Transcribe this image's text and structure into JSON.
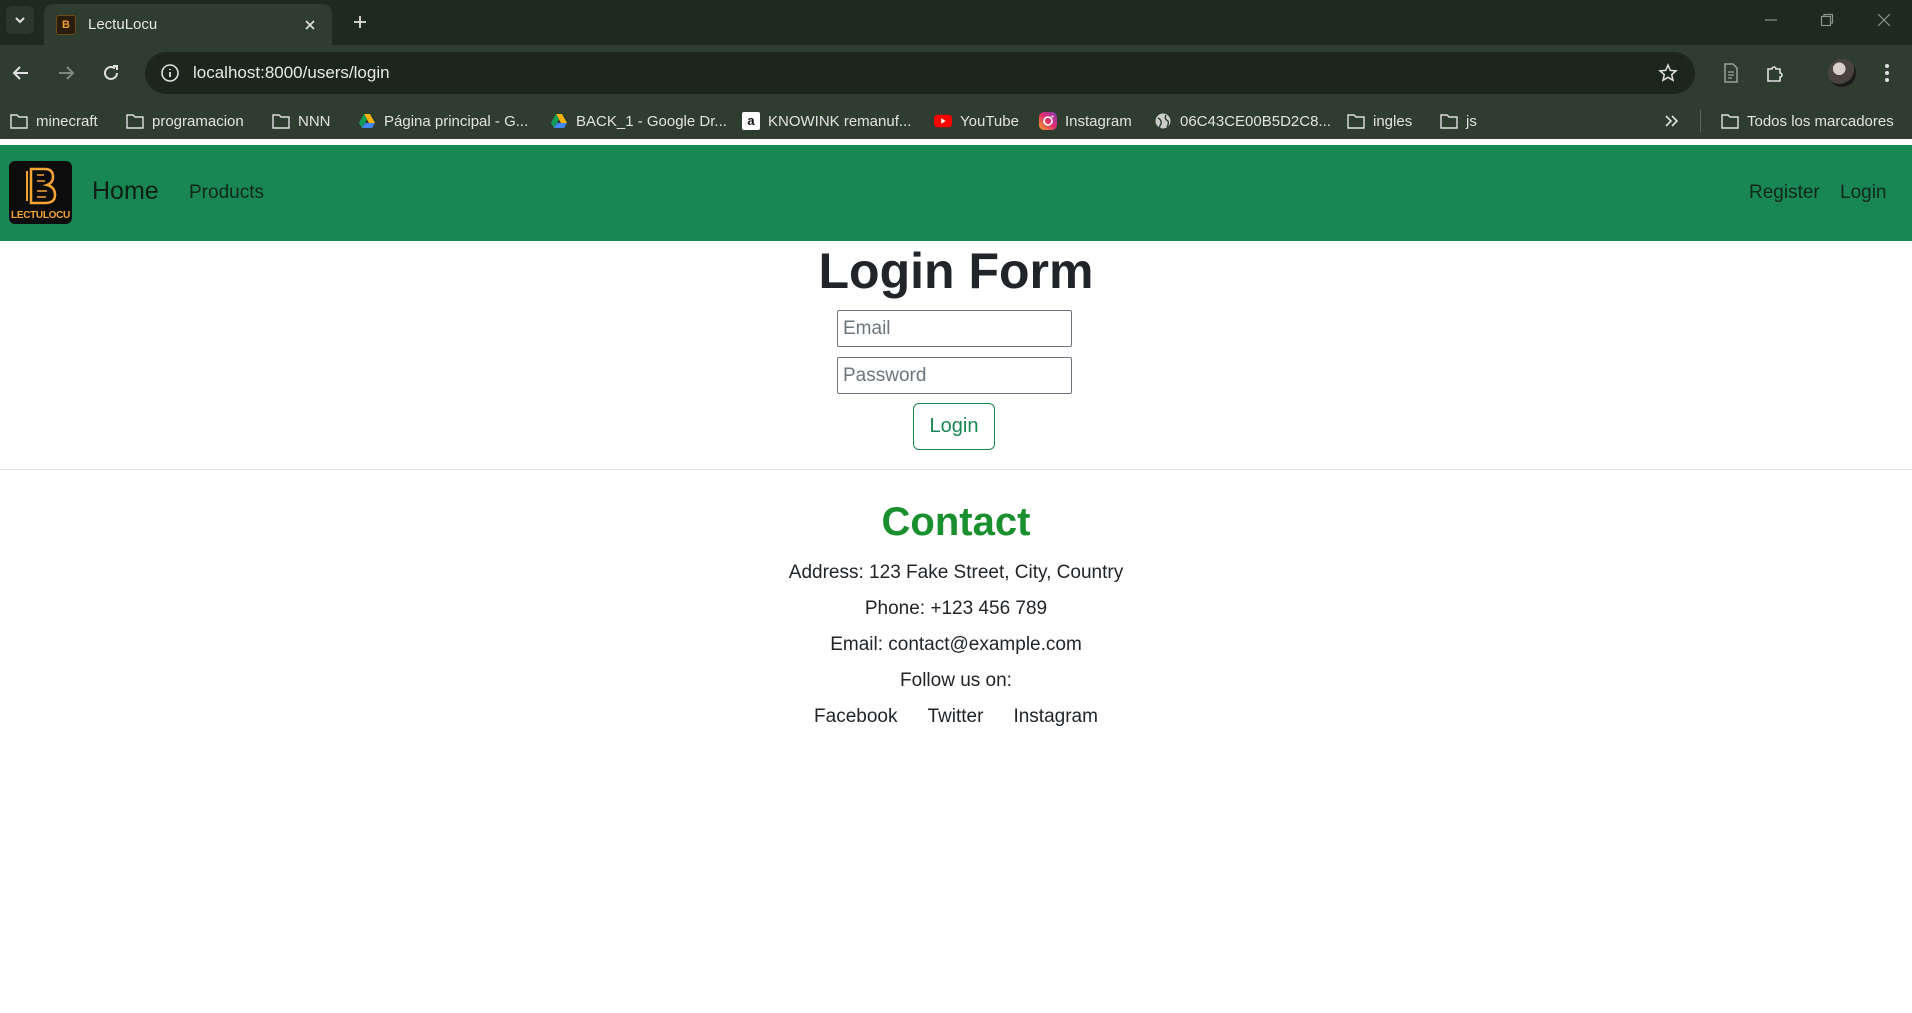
{
  "browser": {
    "tab_title": "LectuLocu",
    "url": "localhost:8000/users/login",
    "bookmarks": [
      {
        "label": "minecraft",
        "icon": "folder-icon"
      },
      {
        "label": "programacion",
        "icon": "folder-icon"
      },
      {
        "label": "NNN",
        "icon": "folder-icon"
      },
      {
        "label": "Página principal - G...",
        "icon": "google-drive-icon"
      },
      {
        "label": "BACK_1 - Google Dr...",
        "icon": "google-drive-icon"
      },
      {
        "label": "KNOWINK remanuf...",
        "icon": "amazon-icon"
      },
      {
        "label": "YouTube",
        "icon": "youtube-icon"
      },
      {
        "label": "Instagram",
        "icon": "instagram-icon"
      },
      {
        "label": "06C43CE00B5D2C8...",
        "icon": "globe-icon"
      },
      {
        "label": "ingles",
        "icon": "folder-icon"
      },
      {
        "label": "js",
        "icon": "folder-icon"
      }
    ],
    "all_bookmarks_label": "Todos los marcadores"
  },
  "navbar": {
    "logo_text": "LECTULOCU",
    "brand": "Home",
    "links": {
      "products": "Products",
      "register": "Register",
      "login": "Login"
    }
  },
  "login_form": {
    "title": "Login Form",
    "email_placeholder": "Email",
    "password_placeholder": "Password",
    "submit_label": "Login"
  },
  "contact": {
    "title": "Contact",
    "address": "Address: 123 Fake Street, City, Country",
    "phone": "Phone: +123 456 789",
    "email": "Email: contact@example.com",
    "follow": "Follow us on:",
    "socials": {
      "facebook": "Facebook",
      "twitter": "Twitter",
      "instagram": "Instagram"
    }
  },
  "colors": {
    "navbar": "#198754",
    "contact_title": "#1a8f2e",
    "chrome": "#2f3d30"
  }
}
